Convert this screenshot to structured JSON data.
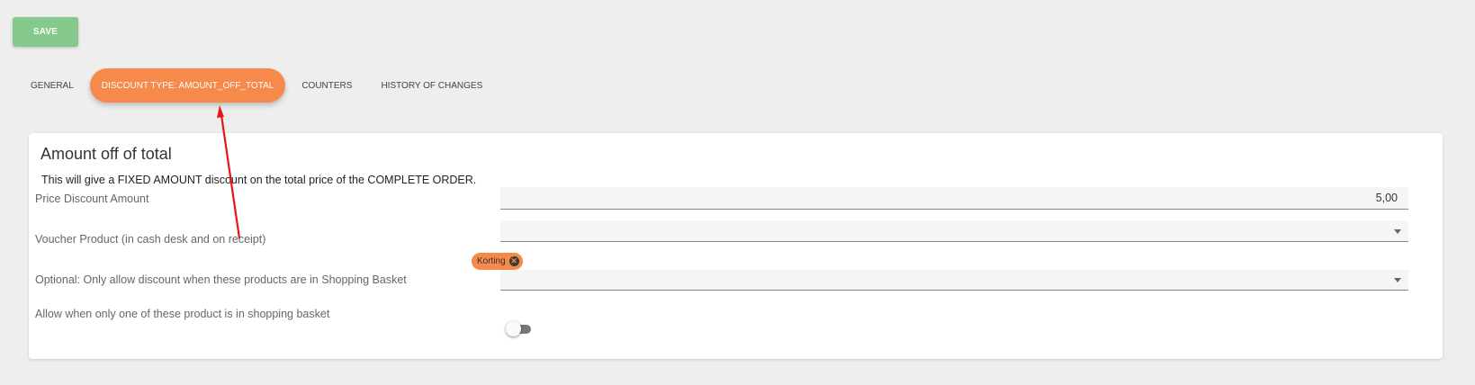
{
  "toolbar": {
    "save_label": "SAVE"
  },
  "tabs": [
    {
      "label": "GENERAL",
      "active": false
    },
    {
      "label": "DISCOUNT TYPE: AMOUNT_OFF_TOTAL",
      "active": true
    },
    {
      "label": "COUNTERS",
      "active": false
    },
    {
      "label": "HISTORY OF CHANGES",
      "active": false
    }
  ],
  "card": {
    "title": "Amount off of total",
    "description": "This will give a FIXED AMOUNT discount on the total price of the COMPLETE ORDER.",
    "fields": {
      "price_discount": {
        "label": "Price Discount Amount",
        "value": "5,00"
      },
      "voucher_product": {
        "label": "Voucher Product (in cash desk and on receipt)",
        "chip": "Korting"
      },
      "optional_products": {
        "label": "Optional: Only allow discount when these products are in Shopping Basket"
      },
      "allow_one": {
        "label": "Allow when only one of these product is in shopping basket",
        "enabled": false
      }
    }
  },
  "colors": {
    "accent": "#f58a4b",
    "save": "#86c98c",
    "annotation_arrow": "#e8141a"
  }
}
